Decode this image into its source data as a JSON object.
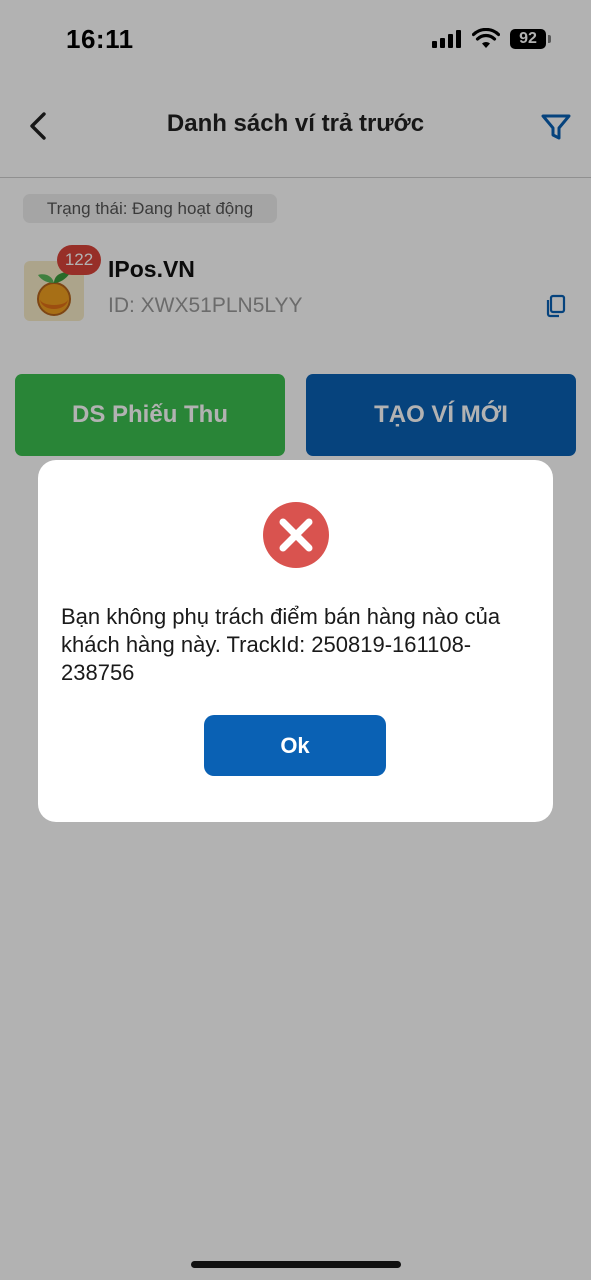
{
  "status_bar": {
    "time": "16:11",
    "battery": "92"
  },
  "header": {
    "title": "Danh sách ví trả trước"
  },
  "filter_chip": {
    "label": "Trạng thái: Đang hoạt động"
  },
  "merchant": {
    "badge_count": "122",
    "name": "IPos.VN",
    "id": "ID: XWX51PLN5LYY"
  },
  "actions": {
    "receipts_label": "DS Phiếu Thu",
    "create_wallet_label": "TẠO VÍ MỚI"
  },
  "dialog": {
    "message": "Bạn không phụ trách điểm bán hàng nào của khách hàng này.  TrackId: 250819-161108-238756",
    "ok_label": "Ok"
  },
  "colors": {
    "primary_blue": "#0a61b4",
    "success_green": "#3bbf4f",
    "error_red": "#d9534f",
    "badge_red": "#d9443a"
  },
  "icons": {
    "back": "chevron-left-icon",
    "filter": "filter-icon",
    "copy": "copy-icon",
    "error": "error-x-icon"
  }
}
